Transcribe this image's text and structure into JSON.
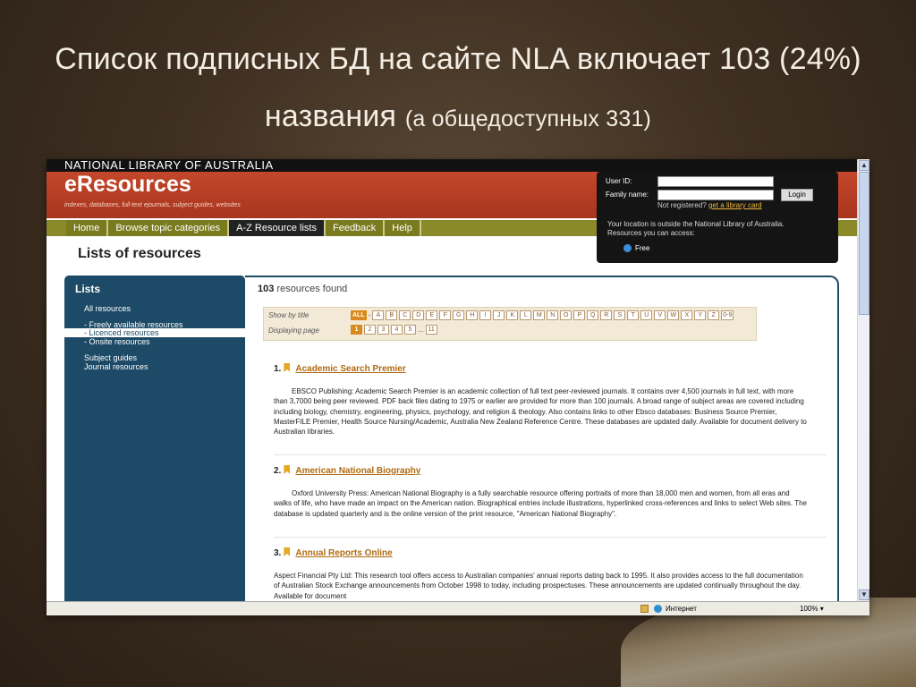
{
  "slide": {
    "title_line1": "Список подписных БД на сайте NLA включает 103 (24%)",
    "title_line2_main": "названия",
    "title_line2_paren": "(а общедоступных 331)"
  },
  "site": {
    "topbar": "NATIONAL LIBRARY OF AUSTRALIA",
    "brand": "eResources",
    "tagline": "indexes, databases, full-text ejournals, subject guides, websites"
  },
  "nav": {
    "items": [
      "Home",
      "Browse topic categories",
      "A-Z Resource lists",
      "Feedback",
      "Help"
    ],
    "active_index": 2
  },
  "login": {
    "user_id_label": "User ID:",
    "family_name_label": "Family name:",
    "login_button": "Login",
    "not_registered": "Not registered?",
    "get_card_link": "get a library card",
    "location_note": "Your location is outside the National Library of Australia. Resources you can access:",
    "free_label": "Free"
  },
  "page_title": "Lists of resources",
  "sidebar": {
    "heading": "Lists",
    "items": [
      "All resources",
      "- Freely available resources",
      "- Licenced resources",
      "- Onsite resources",
      "Subject guides",
      "Journal resources"
    ],
    "selected_index": 2
  },
  "results": {
    "count": "103",
    "count_suffix": "resources found"
  },
  "filter": {
    "show_by_label": "Show by title",
    "all_label": "ALL",
    "dash": "-",
    "letters": [
      "A",
      "B",
      "C",
      "D",
      "E",
      "F",
      "G",
      "H",
      "I",
      "J",
      "K",
      "L",
      "M",
      "N",
      "O",
      "P",
      "Q",
      "R",
      "S",
      "T",
      "U",
      "V",
      "W",
      "X",
      "Y",
      "Z",
      "0-9"
    ],
    "displaying_label": "Displaying page",
    "pages": [
      "1",
      "2",
      "3",
      "4",
      "5"
    ],
    "ellipsis": "...",
    "last_page": "11",
    "current_page": "1"
  },
  "entries": [
    {
      "number": "1.",
      "title": "Academic Search Premier",
      "text": "EBSCO Publishing: Academic Search Premier is an academic collection of full text peer-reviewed journals. It contains over 4,500 journals in full text, with more than 3,7000 being peer reviewed. PDF back files dating to 1975 or earlier are provided for more than 100 journals. A broad range of subject areas are covered including including biology, chemistry, engineering, physics, psychology, and religion & theology. Also contains links to other Ebsco databases: Business Source Premier, MasterFILE Premier, Health Source Nursing/Academic, Australia New Zealand Reference Centre. These databases are updated daily. Available for document delivery to Australian libraries."
    },
    {
      "number": "2.",
      "title": "American National Biography",
      "text": "Oxford University Press: American National Biography is a fully searchable resource offering portraits of more than 18,000 men and women, from all eras and walks of life, who have made an impact on the American nation. Biographical entries include illustrations, hyperlinked cross-references and links to select Web sites. The database is updated quarterly and is the online version of the print resource, \"American National Biography\"."
    },
    {
      "number": "3.",
      "title": "Annual Reports Online",
      "text": "Aspect Financial Pty Ltd: This research tool offers access to Australian companies' annual reports dating back to 1995. It also provides access to the full documentation of Australian Stock Exchange announcements from October 1998 to today, including prospectuses. These announcements are updated continually throughout the day. Available for document"
    }
  ],
  "statusbar": {
    "zone": "Интернет",
    "zoom": "100%"
  }
}
